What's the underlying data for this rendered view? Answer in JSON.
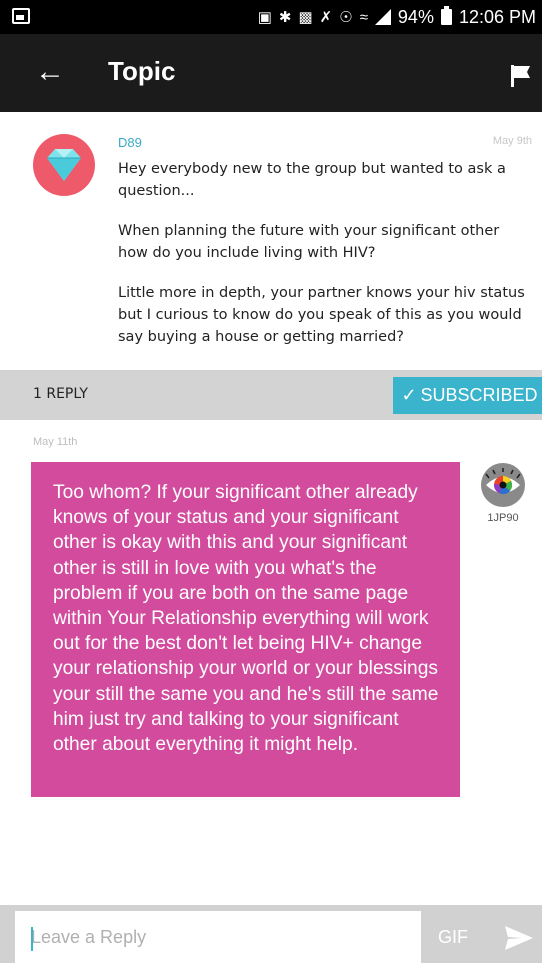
{
  "status_bar": {
    "battery": "94%",
    "time": "12:06 PM"
  },
  "app_bar": {
    "title": "Topic"
  },
  "post": {
    "author": "D89",
    "date": "May 9th",
    "paragraphs": [
      "Hey everybody new to the group but wanted to ask a question...",
      "When planning the future with your significant other how do you include living with HIV?",
      "Little more in depth, your partner knows your hiv status but I curious to know do you speak of this as you would say buying a house or getting married?"
    ]
  },
  "reply_bar": {
    "count_label": "1 REPLY",
    "subscribed_label": "SUBSCRIBED",
    "check": "✓"
  },
  "reply": {
    "date": "May 11th",
    "text": "Too whom? If your significant other already knows of your status and your significant other is okay with this and your significant other is still in love with you what's the problem if you are both on the same page within Your Relationship everything will work out for the best don't let being HIV+ change your relationship your world or your blessings your still the same you and he's still the same him just try and talking to your significant other about everything it might help.",
    "author": "1JP90"
  },
  "input_bar": {
    "placeholder": "Leave a Reply",
    "gif_label": "GIF"
  },
  "colors": {
    "accent": "#3ab3cc",
    "reply_bubble": "#d24b9d",
    "app_bar": "#1b1b1b"
  }
}
